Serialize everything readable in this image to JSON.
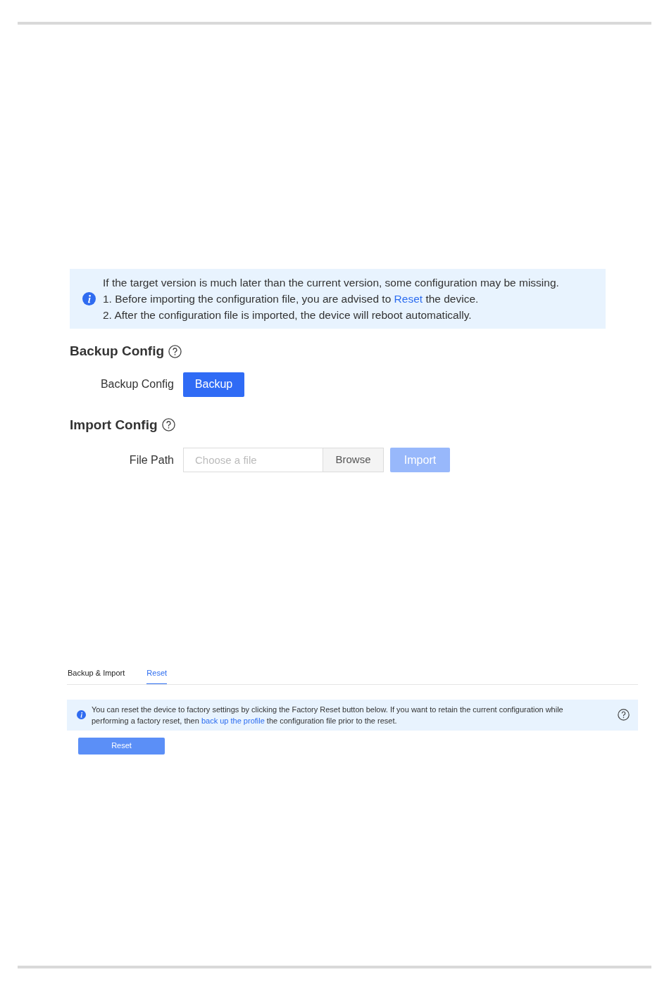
{
  "import_panel": {
    "notice": {
      "lines": [
        {
          "text": "If the target version is much later than the current version, some configuration may be missing."
        },
        {
          "before": "1. Before importing the configuration file, you are advised to ",
          "link": "Reset",
          "after": " the device."
        },
        {
          "text": "2. After the configuration file is imported, the device will reboot automatically."
        }
      ]
    },
    "backup_section": {
      "title": "Backup Config",
      "label": "Backup Config",
      "button": "Backup"
    },
    "import_section": {
      "title": "Import Config",
      "label": "File Path",
      "placeholder": "Choose a file",
      "browse": "Browse",
      "button": "Import",
      "button_disabled": true
    }
  },
  "reset_panel": {
    "tabs": [
      {
        "label": "Backup & Import",
        "selected": false
      },
      {
        "label": "Reset",
        "selected": true
      }
    ],
    "notice": {
      "before": "You can reset the device to factory settings by clicking the Factory Reset button below. If you want to retain the current configuration while performing a factory reset, then ",
      "link": "back up the profile",
      "after": " the configuration file prior to the reset."
    },
    "button": "Reset"
  }
}
